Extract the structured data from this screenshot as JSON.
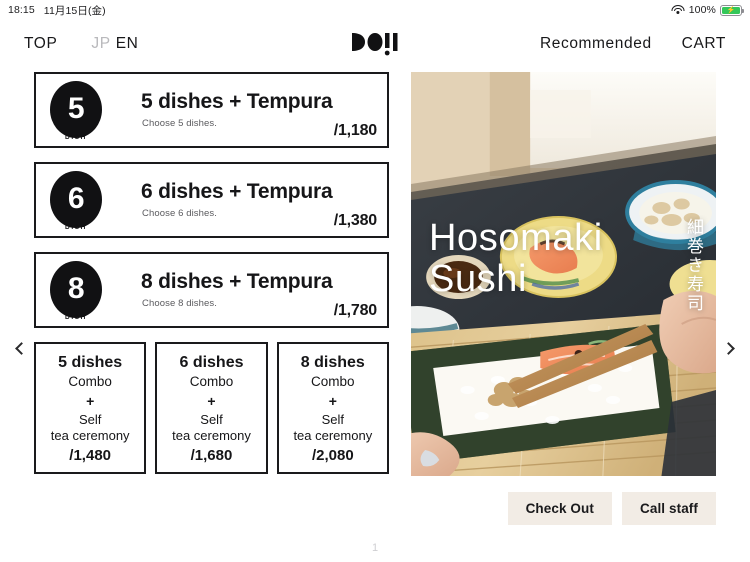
{
  "status_bar": {
    "time": "18:15",
    "date": "11月15日(金)",
    "wifi_icon": "wifi-icon",
    "battery_percent": "100%",
    "battery_icon": "battery-charging-icon"
  },
  "header": {
    "top_label": "TOP",
    "lang_jp": "JP",
    "lang_en": "EN",
    "logo_alt": "doii-logo",
    "recommended_label": "Recommended",
    "cart_label": "CART"
  },
  "nav": {
    "prev_icon": "chevron-left-icon",
    "next_icon": "chevron-right-icon"
  },
  "dish_cards": [
    {
      "number": "5",
      "badge_label": "DISH",
      "title": "5 dishes + Tempura",
      "subtitle": "Choose 5 dishes.",
      "price": "/1,180"
    },
    {
      "number": "6",
      "badge_label": "DISH",
      "title": "6 dishes + Tempura",
      "subtitle": "Choose 6 dishes.",
      "price": "/1,380"
    },
    {
      "number": "8",
      "badge_label": "DISH",
      "title": "8 dishes + Tempura",
      "subtitle": "Choose 8 dishes.",
      "price": "/1,780"
    }
  ],
  "combo_cards": [
    {
      "dishes": "5 dishes",
      "combo": "Combo",
      "plus": "+",
      "self": "Self",
      "ceremony": "tea ceremony",
      "price": "/1,480"
    },
    {
      "dishes": "6 dishes",
      "combo": "Combo",
      "plus": "+",
      "self": "Self",
      "ceremony": "tea ceremony",
      "price": "/1,680"
    },
    {
      "dishes": "8 dishes",
      "combo": "Combo",
      "plus": "+",
      "self": "Self",
      "ceremony": "tea ceremony",
      "price": "/2,080"
    }
  ],
  "hero": {
    "title_line1": "Hosomaki",
    "title_line2": "Sushi",
    "title_jp": "細巻き寿司",
    "image_alt": "hosomaki-sushi-preparation-photo"
  },
  "footer": {
    "check_out_label": "Check Out",
    "call_staff_label": "Call staff",
    "page_number": "1"
  },
  "colors": {
    "accent_button": "#f2ece5",
    "ink": "#161618",
    "muted": "#b9b9bc",
    "battery_green": "#34c759"
  }
}
